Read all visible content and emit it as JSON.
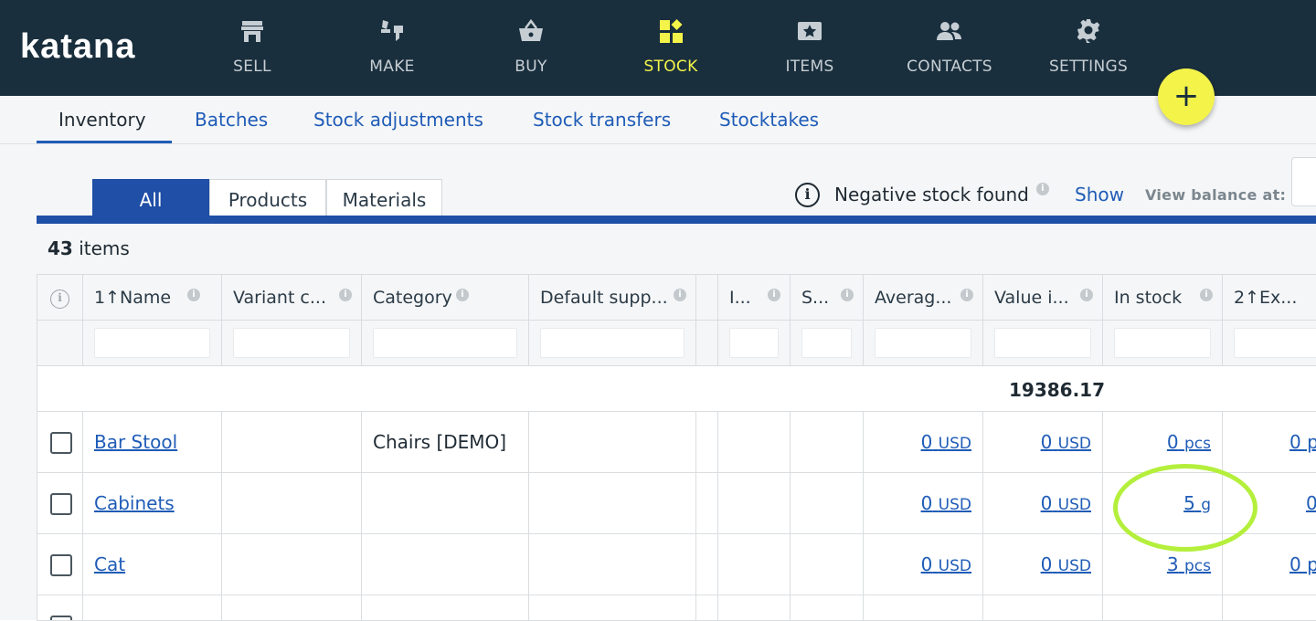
{
  "app": {
    "logo": "katana"
  },
  "nav": [
    {
      "label": "SELL",
      "icon": "store-icon"
    },
    {
      "label": "MAKE",
      "icon": "wrench-hammer-icon"
    },
    {
      "label": "BUY",
      "icon": "basket-icon"
    },
    {
      "label": "STOCK",
      "icon": "boxes-icon",
      "active": true
    },
    {
      "label": "ITEMS",
      "icon": "items-tag-icon"
    },
    {
      "label": "CONTACTS",
      "icon": "people-icon"
    },
    {
      "label": "SETTINGS",
      "icon": "gear-icon"
    }
  ],
  "fab": {
    "label": "+"
  },
  "subtabs": [
    "Inventory",
    "Batches",
    "Stock adjustments",
    "Stock transfers",
    "Stocktakes"
  ],
  "filter_tabs": [
    "All",
    "Products",
    "Materials"
  ],
  "notice": {
    "text": "Negative stock found",
    "show": "Show",
    "view_balance": "View balance at:"
  },
  "count": {
    "number": "43",
    "label": "items"
  },
  "columns": [
    "1↑Name",
    "Variant c...",
    "Category",
    "Default supp...",
    "I...",
    "S...",
    "Averag...",
    "Value i...",
    "In stock",
    "2↑Ex..."
  ],
  "totals": {
    "value_in_stock": "19386.17"
  },
  "rows": [
    {
      "name": "Bar Stool",
      "category": "Chairs [DEMO]",
      "avg_val": "0",
      "avg_unit": "USD",
      "value_val": "0",
      "value_unit": "USD",
      "stock_val": "0",
      "stock_unit": "pcs",
      "ex": "0 p"
    },
    {
      "name": "Cabinets",
      "category": "",
      "avg_val": "0",
      "avg_unit": "USD",
      "value_val": "0",
      "value_unit": "USD",
      "stock_val": "5",
      "stock_unit": "g",
      "ex": "0"
    },
    {
      "name": "Cat",
      "category": "",
      "avg_val": "0",
      "avg_unit": "USD",
      "value_val": "0",
      "value_unit": "USD",
      "stock_val": "3",
      "stock_unit": "pcs",
      "ex": "0 p"
    }
  ],
  "colors": {
    "topbar": "#1a2f3d",
    "accent_yellow": "#f3f34a",
    "primary_blue": "#1f4fa6",
    "link_blue": "#1f5cb7",
    "highlight_green": "#b4ef3c"
  }
}
